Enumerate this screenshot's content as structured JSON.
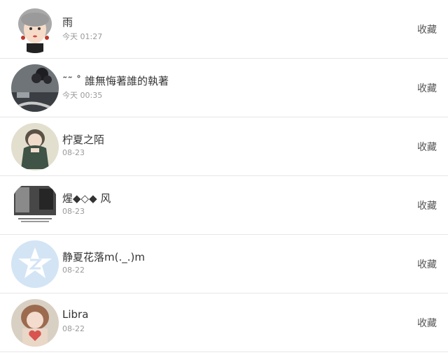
{
  "items": [
    {
      "name": "雨",
      "time": "今天 01:27",
      "action": "收藏",
      "avatar_icon": "girl-cartoon-avatar"
    },
    {
      "name": "˜˜ ˚ 誰無悔著誰的執著",
      "time": "今天 00:35",
      "action": "收藏",
      "avatar_icon": "dark-flowers-avatar"
    },
    {
      "name": "柠夏之陌",
      "time": "08-23",
      "action": "收藏",
      "avatar_icon": "girl-green-dress-avatar"
    },
    {
      "name": "煋◆◇◆ 风",
      "time": "08-23",
      "action": "收藏",
      "avatar_icon": "bw-photo-avatar"
    },
    {
      "name": "静夏花落m(._.)m",
      "time": "08-22",
      "action": "收藏",
      "avatar_icon": "default-qq-avatar"
    },
    {
      "name": "Libra",
      "time": "08-22",
      "action": "收藏",
      "avatar_icon": "girl-heart-avatar"
    }
  ],
  "colors": {
    "name": "#333333",
    "time": "#9a9a9a",
    "divider": "#e6e6e6",
    "qq_blue": "#d3e4f5"
  }
}
